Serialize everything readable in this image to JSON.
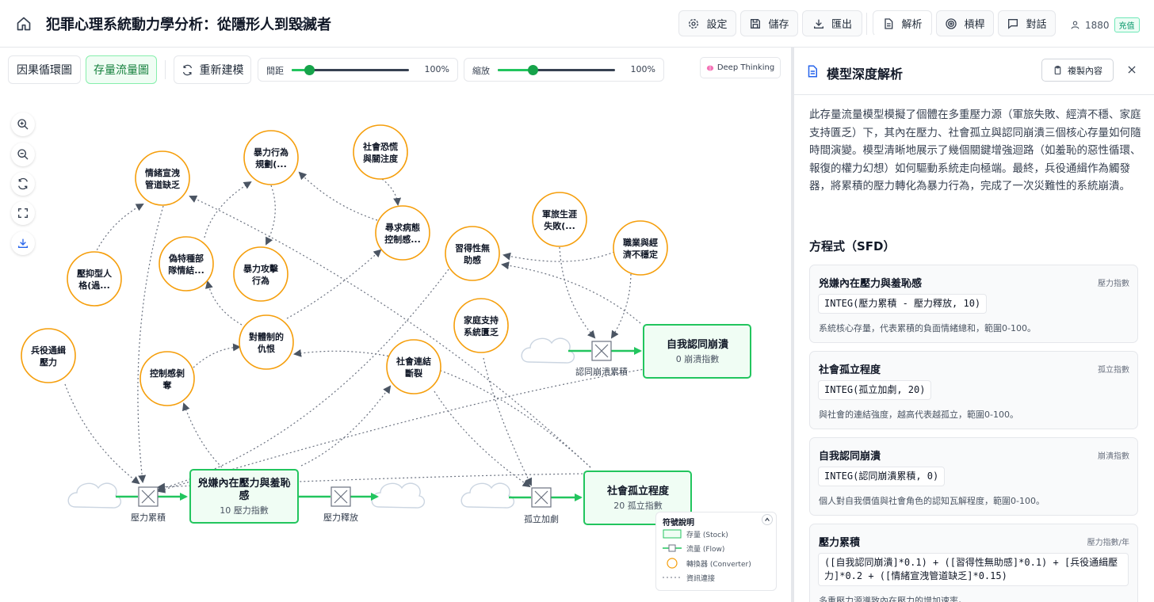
{
  "header": {
    "title": "犯罪心理系統動力學分析：從隱形人到毀滅者",
    "buttons": [
      {
        "label": "設定",
        "icon": "gear-icon"
      },
      {
        "label": "儲存",
        "icon": "save-icon"
      },
      {
        "label": "匯出",
        "icon": "download-icon"
      },
      {
        "label": "解析",
        "icon": "document-icon"
      },
      {
        "label": "槓桿",
        "icon": "target-icon"
      },
      {
        "label": "對話",
        "icon": "chat-icon"
      }
    ],
    "user_count": "1880",
    "recharge_label": "充值"
  },
  "toolbar": {
    "causal_loop_label": "因果循環圖",
    "stock_flow_label": "存量流量圖",
    "rebuild_label": "重新建模",
    "spacing_label": "間距",
    "spacing_value": "100%",
    "spacing_level": 0.15,
    "zoom_label": "縮放",
    "zoom_value": "100%",
    "zoom_level": 0.3,
    "deep_thinking_label": "Deep Thinking"
  },
  "converters": [
    {
      "id": "c1",
      "label": [
        "情緒宣洩",
        "管道缺乏"
      ]
    },
    {
      "id": "c2",
      "label": [
        "暴力行為",
        "規劃(..."
      ]
    },
    {
      "id": "c3",
      "label": [
        "社會恐慌",
        "與關注度"
      ]
    },
    {
      "id": "c4",
      "label": [
        "軍旅生涯",
        "失敗(..."
      ]
    },
    {
      "id": "c5",
      "label": [
        "壓抑型人",
        "格(過..."
      ]
    },
    {
      "id": "c6",
      "label": [
        "偽特種部",
        "隊情結..."
      ]
    },
    {
      "id": "c7",
      "label": [
        "暴力攻擊",
        "行為"
      ]
    },
    {
      "id": "c8",
      "label": [
        "尋求病態",
        "控制感..."
      ]
    },
    {
      "id": "c9",
      "label": [
        "習得性無",
        "助感"
      ]
    },
    {
      "id": "c10",
      "label": [
        "職業與經",
        "濟不穩定"
      ]
    },
    {
      "id": "c11",
      "label": [
        "兵役通緝",
        "壓力"
      ]
    },
    {
      "id": "c12",
      "label": [
        "對體制的",
        "仇恨"
      ]
    },
    {
      "id": "c13",
      "label": [
        "家庭支持",
        "系統匱乏"
      ]
    },
    {
      "id": "c14",
      "label": [
        "控制感剝",
        "奪"
      ]
    },
    {
      "id": "c15",
      "label": [
        "社會連結",
        "斷裂"
      ]
    }
  ],
  "stocks": [
    {
      "id": "s1",
      "title": [
        "兇嫌內在壓力與羞恥",
        "感"
      ],
      "value": "10 壓力指數"
    },
    {
      "id": "s2",
      "title": [
        "社會孤立程度"
      ],
      "value": "20 孤立指數"
    },
    {
      "id": "s3",
      "title": [
        "自我認同崩潰"
      ],
      "value": "0 崩潰指數"
    }
  ],
  "flows": [
    {
      "id": "f1",
      "label": "壓力累積"
    },
    {
      "id": "f2",
      "label": "壓力釋放"
    },
    {
      "id": "f3",
      "label": "孤立加劇"
    },
    {
      "id": "f4",
      "label": "認同崩潰累積"
    }
  ],
  "legend": {
    "title": "符號說明",
    "items": [
      {
        "label": "存量 (Stock)"
      },
      {
        "label": "流量 (Flow)"
      },
      {
        "label": "轉換器 (Converter)"
      },
      {
        "label": "資訊連接"
      }
    ]
  },
  "panel": {
    "title": "模型深度解析",
    "copy_label": "複製內容",
    "description": "此存量流量模型模擬了個體在多重壓力源（軍旅失敗、經濟不穩、家庭支持匱乏）下，其內在壓力、社會孤立與認同崩潰三個核心存量如何隨時間演變。模型清晰地展示了幾個關鍵增強迴路（如羞恥的惡性循環、報復的權力幻想）如何驅動系統走向極端。最終，兵役通緝作為觸發器，將累積的壓力轉化為暴力行為，完成了一次災難性的系統崩潰。",
    "equations_heading": "方程式（SFD）",
    "equations": [
      {
        "name": "兇嫌內在壓力與羞恥感",
        "unit": "壓力指數",
        "formula": [
          "INTEG(壓力累積 - 壓力釋放, 10)"
        ],
        "desc": "系統核心存量，代表累積的負面情緒總和，範圍0-100。"
      },
      {
        "name": "社會孤立程度",
        "unit": "孤立指數",
        "formula": [
          "INTEG(孤立加劇, 20)"
        ],
        "desc": "與社會的連結強度，越高代表越孤立，範圍0-100。"
      },
      {
        "name": "自我認同崩潰",
        "unit": "崩潰指數",
        "formula": [
          "INTEG(認同崩潰累積, 0)"
        ],
        "desc": "個人對自我價值與社會角色的認知瓦解程度，範圍0-100。"
      },
      {
        "name": "壓力累積",
        "unit": "壓力指數/年",
        "formula": [
          "([自我認同崩潰]*0.1) + ([習得性無助感]*0.1) + [兵役通緝壓",
          "力]*0.2 + ([情緒宣洩管道缺乏]*0.15)"
        ],
        "desc": "多重壓力源導致內在壓力的增加速率。"
      }
    ]
  }
}
